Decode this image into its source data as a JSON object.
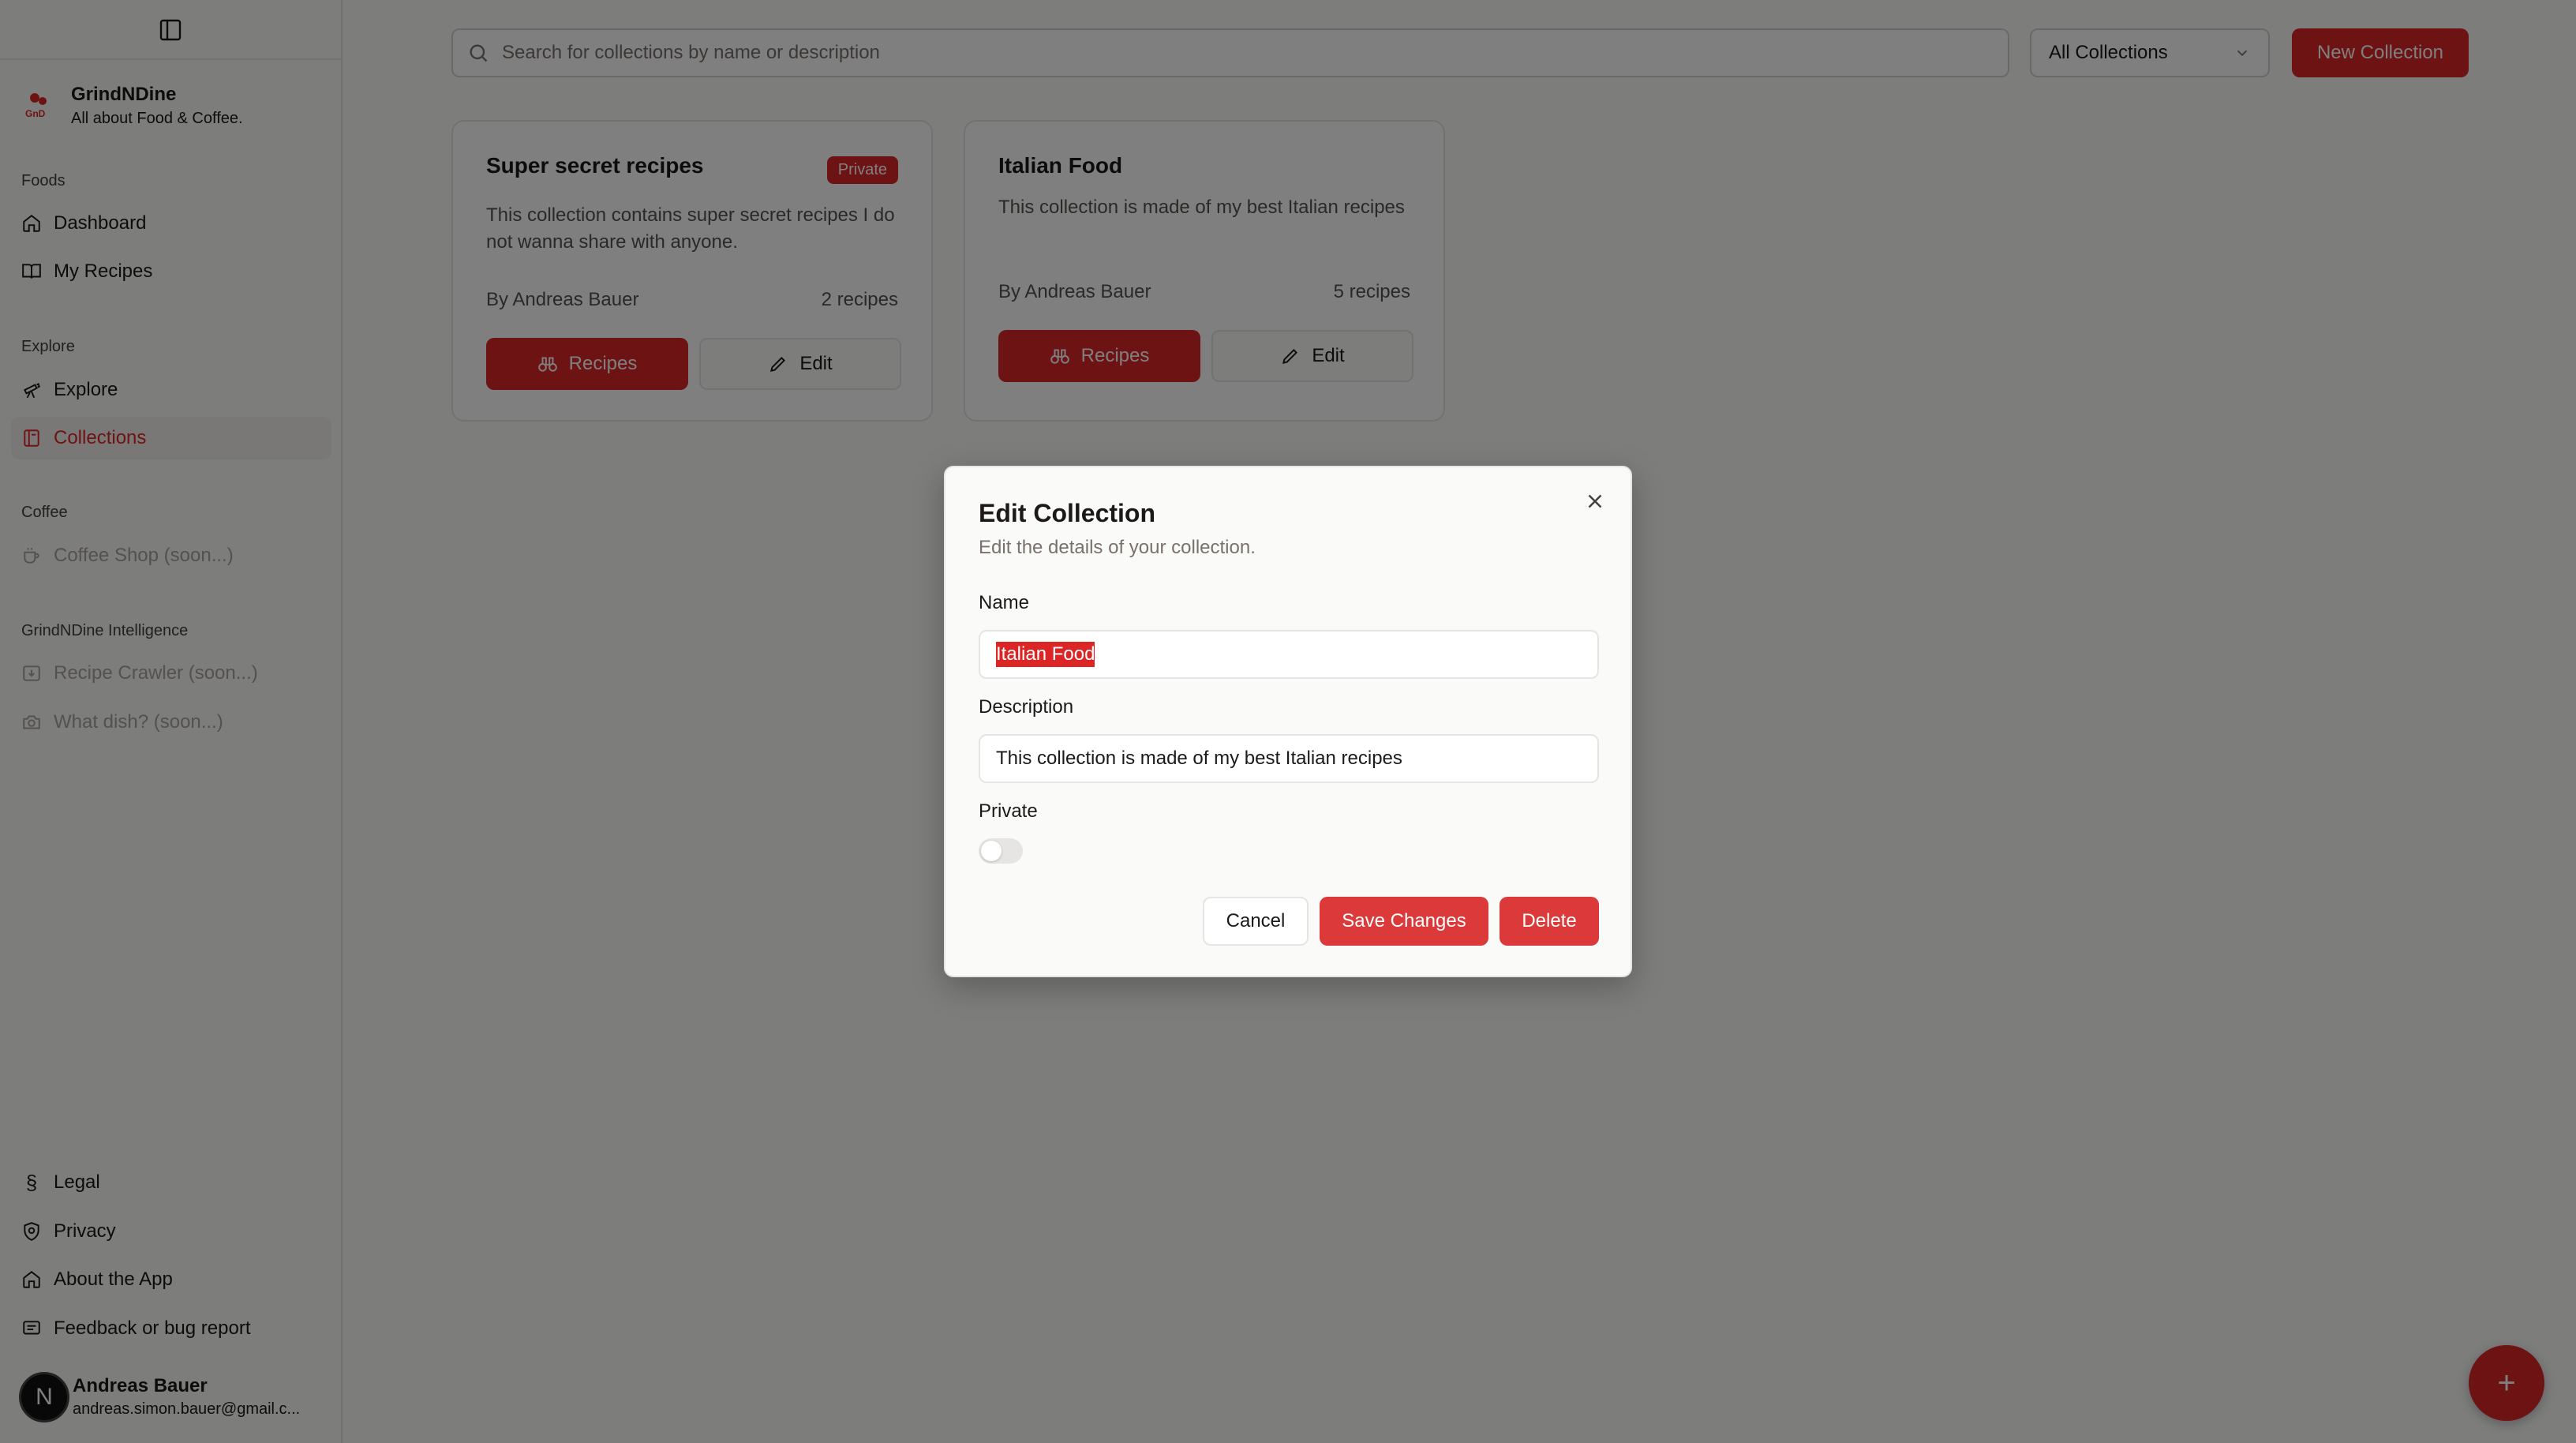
{
  "brand": {
    "name": "GrindNDine",
    "tagline": "All about Food & Coffee."
  },
  "sidebar": {
    "groups": [
      {
        "label": "Foods"
      },
      {
        "label": "Explore"
      },
      {
        "label": "Coffee"
      },
      {
        "label": "GrindNDine Intelligence"
      }
    ],
    "items": [
      {
        "label": "Dashboard",
        "icon": "home-icon"
      },
      {
        "label": "My Recipes",
        "icon": "book-icon"
      },
      {
        "label": "Explore",
        "icon": "telescope-icon"
      },
      {
        "label": "Collections",
        "icon": "collection-icon",
        "active": true
      },
      {
        "label": "Coffee Shop (soon...)",
        "icon": "coffee-icon",
        "disabled": true
      },
      {
        "label": "Recipe Crawler (soon...)",
        "icon": "download-icon",
        "disabled": true
      },
      {
        "label": "What dish? (soon...)",
        "icon": "camera-icon",
        "disabled": true
      }
    ],
    "footer_items": [
      {
        "label": "Legal",
        "icon": "section-icon"
      },
      {
        "label": "Privacy",
        "icon": "shield-icon"
      },
      {
        "label": "About the App",
        "icon": "home-icon"
      },
      {
        "label": "Feedback or bug report",
        "icon": "message-icon"
      }
    ],
    "user": {
      "initial": "N",
      "name": "Andreas Bauer",
      "email": "andreas.simon.bauer@gmail.c..."
    }
  },
  "toolbar": {
    "search_placeholder": "Search for collections by name or description",
    "filter_value": "All Collections",
    "new_label": "New Collection"
  },
  "cards": [
    {
      "title": "Super secret recipes",
      "badge": "Private",
      "description": "This collection contains super secret recipes I do not wanna share with anyone.",
      "author": "By Andreas Bauer",
      "count": "2 recipes",
      "recipes_label": "Recipes",
      "edit_label": "Edit"
    },
    {
      "title": "Italian Food",
      "description": "This collection is made of my best Italian recipes",
      "author": "By Andreas Bauer",
      "count": "5 recipes",
      "recipes_label": "Recipes",
      "edit_label": "Edit"
    }
  ],
  "fab_label": "+",
  "modal": {
    "title": "Edit Collection",
    "subtitle": "Edit the details of your collection.",
    "name_label": "Name",
    "name_value": "Italian Food",
    "description_label": "Description",
    "description_value": "This collection is made of my best Italian recipes",
    "private_label": "Private",
    "private_on": false,
    "cancel_label": "Cancel",
    "save_label": "Save Changes",
    "delete_label": "Delete"
  },
  "colors": {
    "accent": "#dc2626",
    "overlay": "rgba(0,0,0,0.5)"
  }
}
